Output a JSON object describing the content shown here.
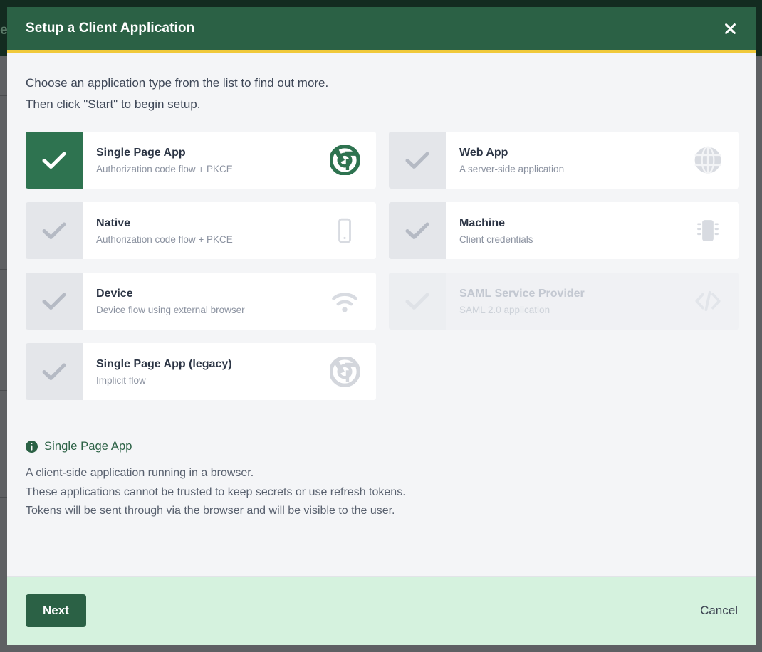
{
  "backdrop": {
    "clipped_text": "ec"
  },
  "header": {
    "title": "Setup a Client Application",
    "close_icon": "close-icon",
    "bg_color": "#2b6145",
    "accent_color": "#f0c93b"
  },
  "intro": {
    "line1": "Choose an application type from the list to find out more.",
    "line2": "Then click \"Start\" to begin setup."
  },
  "cards": [
    {
      "title": "Single Page App",
      "subtitle": "Authorization code flow + PKCE",
      "icon": "chrome-icon",
      "selected": true,
      "disabled": false
    },
    {
      "title": "Web App",
      "subtitle": "A server-side application",
      "icon": "globe-icon",
      "selected": false,
      "disabled": false
    },
    {
      "title": "Native",
      "subtitle": "Authorization code flow + PKCE",
      "icon": "mobile-phone-icon",
      "selected": false,
      "disabled": false
    },
    {
      "title": "Machine",
      "subtitle": "Client credentials",
      "icon": "microchip-icon",
      "selected": false,
      "disabled": false
    },
    {
      "title": "Device",
      "subtitle": "Device flow using external browser",
      "icon": "wifi-icon",
      "selected": false,
      "disabled": false
    },
    {
      "title": "SAML Service Provider",
      "subtitle": "SAML 2.0 application",
      "icon": "code-brackets-icon",
      "selected": false,
      "disabled": true
    },
    {
      "title": "Single Page App (legacy)",
      "subtitle": "Implicit flow",
      "icon": "chrome-icon",
      "selected": false,
      "disabled": false
    }
  ],
  "info": {
    "icon": "info-circle-icon",
    "title": "Single Page App",
    "lines": [
      "A client-side application running in a browser.",
      "These applications cannot be trusted to keep secrets or use refresh tokens.",
      "Tokens will be sent through via the browser and will be visible to the user."
    ]
  },
  "footer": {
    "next_label": "Next",
    "cancel_label": "Cancel",
    "bg_color": "#d5f2de",
    "next_color": "#2b6145"
  }
}
